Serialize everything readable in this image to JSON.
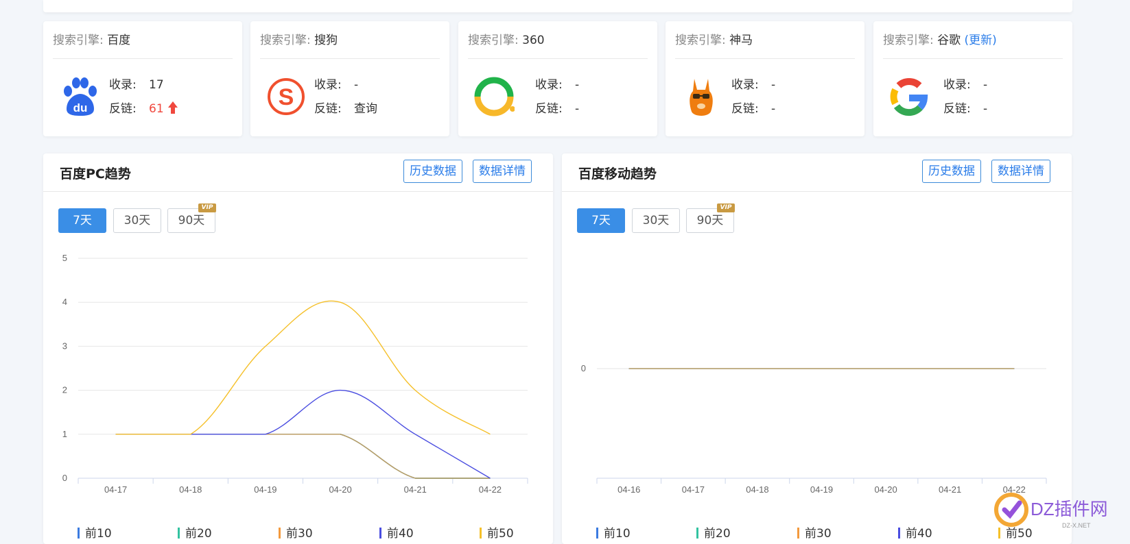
{
  "engine_label": "搜索引擎:",
  "cards": [
    {
      "engine": "百度",
      "update": "",
      "index_label": "收录:",
      "index_value": "17",
      "link_label": "反链:",
      "link_value": "61",
      "link_up": true
    },
    {
      "engine": "搜狗",
      "update": "",
      "index_label": "收录:",
      "index_value": "-",
      "link_label": "反链:",
      "link_value": "查询",
      "link_up": false
    },
    {
      "engine": "360",
      "update": "",
      "index_label": "收录:",
      "index_value": "-",
      "link_label": "反链:",
      "link_value": "-",
      "link_up": false
    },
    {
      "engine": "神马",
      "update": "",
      "index_label": "收录:",
      "index_value": "-",
      "link_label": "反链:",
      "link_value": "-",
      "link_up": false
    },
    {
      "engine": "谷歌",
      "update": "(更新)",
      "index_label": "收录:",
      "index_value": "-",
      "link_label": "反链:",
      "link_value": "-",
      "link_up": false
    }
  ],
  "panels": [
    {
      "title": "百度PC趋势",
      "history_btn": "历史数据",
      "detail_btn": "数据详情",
      "ranges": [
        "7天",
        "30天",
        "90天"
      ],
      "vip_badge": "VIP",
      "legend": [
        "前10",
        "前20",
        "前30",
        "前40",
        "前50"
      ]
    },
    {
      "title": "百度移动趋势",
      "history_btn": "历史数据",
      "detail_btn": "数据详情",
      "ranges": [
        "7天",
        "30天",
        "90天"
      ],
      "vip_badge": "VIP",
      "legend": [
        "前10",
        "前20",
        "前30",
        "前40",
        "前50"
      ]
    }
  ],
  "colors": {
    "top10": "#3b7be0",
    "top20": "#33c3a0",
    "top30": "#f39a3e",
    "top40": "#4a4de0",
    "top50": "#f5c02a"
  },
  "chart_data": [
    {
      "type": "line",
      "title": "百度PC趋势",
      "x": [
        "04-17",
        "04-18",
        "04-19",
        "04-20",
        "04-21",
        "04-22"
      ],
      "ylim": [
        0,
        5
      ],
      "yticks": [
        0,
        1,
        2,
        3,
        4,
        5
      ],
      "grid": true,
      "legend_position": "bottom",
      "series": [
        {
          "name": "前10",
          "color": "#3b7be0",
          "values": [
            1,
            1,
            1,
            1,
            0,
            0
          ]
        },
        {
          "name": "前20",
          "color": "#33c3a0",
          "values": [
            1,
            1,
            1,
            1,
            0,
            0
          ]
        },
        {
          "name": "前30",
          "color": "#c49a5e",
          "values": [
            1,
            1,
            1,
            1,
            0,
            0
          ]
        },
        {
          "name": "前40",
          "color": "#4a4de0",
          "values": [
            1,
            1,
            1,
            2,
            1,
            0
          ]
        },
        {
          "name": "前50",
          "color": "#f5c02a",
          "values": [
            1,
            1,
            3,
            4,
            2,
            1
          ]
        }
      ]
    },
    {
      "type": "line",
      "title": "百度移动趋势",
      "x": [
        "04-16",
        "04-17",
        "04-18",
        "04-19",
        "04-20",
        "04-21",
        "04-22"
      ],
      "ylim": [
        0,
        0
      ],
      "yticks": [
        0
      ],
      "grid": true,
      "legend_position": "bottom",
      "series": [
        {
          "name": "前10",
          "color": "#3b7be0",
          "values": [
            0,
            0,
            0,
            0,
            0,
            0,
            0
          ]
        },
        {
          "name": "前20",
          "color": "#33c3a0",
          "values": [
            0,
            0,
            0,
            0,
            0,
            0,
            0
          ]
        },
        {
          "name": "前30",
          "color": "#f39a3e",
          "values": [
            0,
            0,
            0,
            0,
            0,
            0,
            0
          ]
        },
        {
          "name": "前40",
          "color": "#4a4de0",
          "values": [
            0,
            0,
            0,
            0,
            0,
            0,
            0
          ]
        },
        {
          "name": "前50",
          "color": "#d9c17a",
          "values": [
            0,
            0,
            0,
            0,
            0,
            0,
            0
          ]
        }
      ]
    }
  ],
  "watermark": {
    "brand": "DZ插件网",
    "url": "DZ-X.NET"
  }
}
